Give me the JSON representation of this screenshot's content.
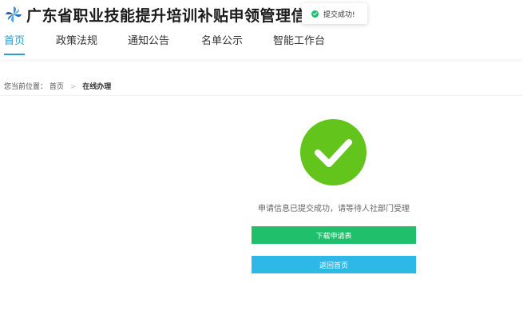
{
  "header": {
    "title": "广东省职业技能提升培训补贴申领管理信息",
    "logo_icon": "pinwheel-logo-icon"
  },
  "nav": {
    "items": [
      {
        "label": "首页",
        "active": true
      },
      {
        "label": "政策法规",
        "active": false
      },
      {
        "label": "通知公告",
        "active": false
      },
      {
        "label": "名单公示",
        "active": false
      },
      {
        "label": "智能工作台",
        "active": false
      }
    ]
  },
  "toast": {
    "text": "提交成功!",
    "icon": "check-circle-icon",
    "color": "#1fbe6a"
  },
  "breadcrumb": {
    "prefix": "您当前位置：",
    "home": "首页",
    "separator": ">",
    "current": "在线办理"
  },
  "result": {
    "icon": "success-check-icon",
    "icon_color": "#63c41c",
    "message": "申请信息已提交成功，请等待人社部门受理",
    "download_button": "下载申请表",
    "home_button": "返回首页"
  },
  "colors": {
    "accent": "#2e9bd8",
    "download_button": "#20bf6c",
    "home_button": "#2db8e8"
  }
}
